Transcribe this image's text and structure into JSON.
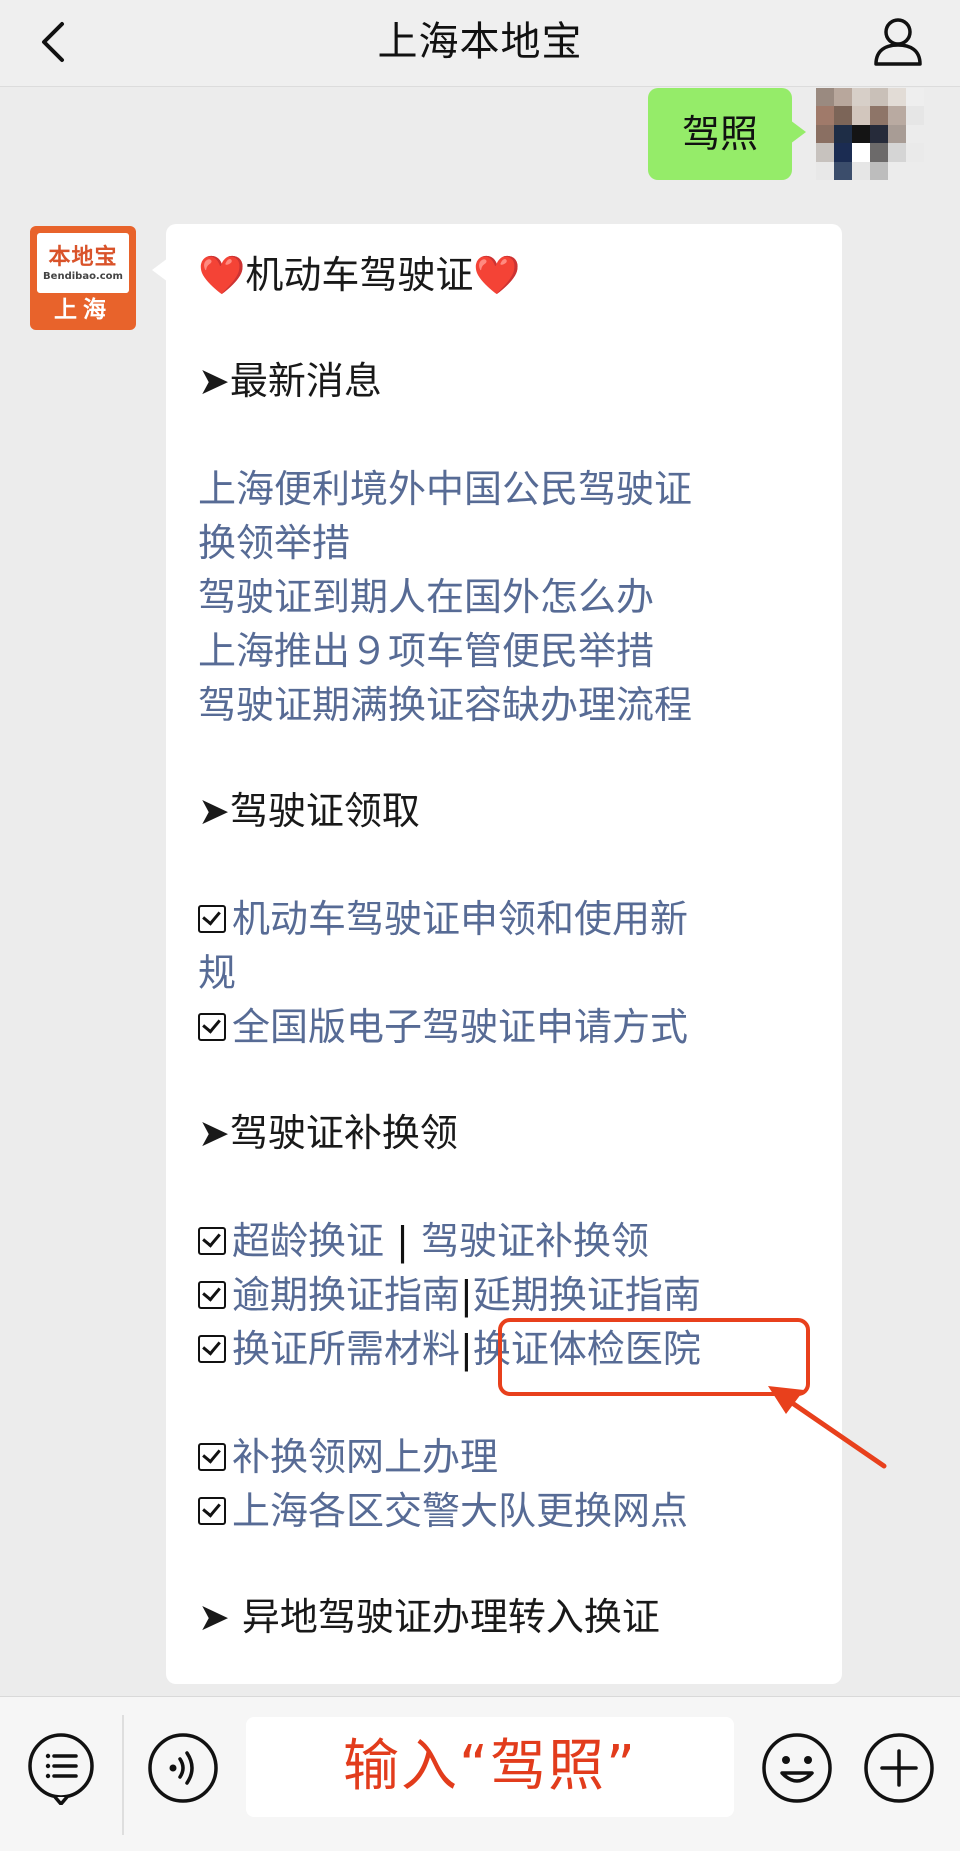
{
  "header": {
    "title": "上海本地宝"
  },
  "my_message": {
    "text": "驾照"
  },
  "bot_avatar": {
    "brand": "本地宝",
    "site": "Bendibao.com",
    "city": "上海"
  },
  "card": {
    "title": "❤️机动车驾驶证❤️",
    "section_latest": {
      "heading": "➤最新消息",
      "links": [
        "上海便利境外中国公民驾驶证",
        "换领举措",
        "驾驶证到期人在国外怎么办",
        "上海推出９项车管便民举措",
        "驾驶证期满换证容缺办理流程"
      ]
    },
    "section_get": {
      "heading": "➤驾驶证领取",
      "item1_line1": "机动车驾驶证申领和使用新",
      "item1_line2": "规",
      "item2": "全国版电子驾驶证申请方式"
    },
    "section_renew": {
      "heading": "➤驾驶证补换领",
      "row1_a": "超龄换证",
      "row1_sep": " | ",
      "row1_b": "驾驶证补换领",
      "row2_a": "逾期换证指南",
      "row2_sep": "|",
      "row2_b": "延期换证指南",
      "row3_a": "换证所需材料",
      "row3_sep": "|",
      "row3_b": "换证体检医院",
      "row4": "补换领网上办理",
      "row5": "上海各区交警大队更换网点"
    },
    "section_transfer": {
      "heading": "➤ 异地驾驶证办理转入换证"
    }
  },
  "input": {
    "value": "输入“驾照”"
  },
  "colors": {
    "link": "#576b95",
    "bubble_green": "#95ec69",
    "highlight": "#e8401c"
  },
  "icons": [
    "back-icon",
    "user-icon",
    "menu-icon",
    "voice-icon",
    "emoji-icon",
    "plus-icon",
    "arrow-icon"
  ]
}
